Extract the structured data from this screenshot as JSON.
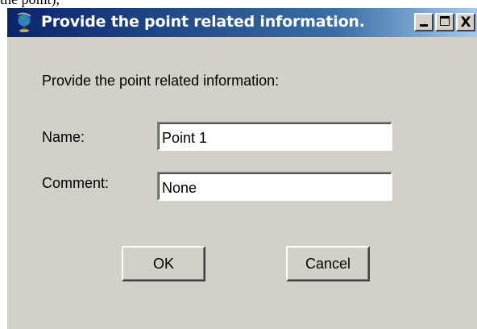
{
  "background_text": "the point),",
  "window": {
    "title": "Provide the point related information.",
    "icon": "globe-icon",
    "controls": {
      "minimize_icon": "minimize-icon",
      "maximize_icon": "maximize-icon",
      "close_label": "X"
    }
  },
  "form": {
    "prompt": "Provide the point related information:",
    "name_label": "Name:",
    "name_value": "Point 1",
    "comment_label": "Comment:",
    "comment_value": "None"
  },
  "buttons": {
    "ok_label": "OK",
    "cancel_label": "Cancel"
  },
  "colors": {
    "titlebar_start": "#0a246a",
    "titlebar_end": "#a6caf0",
    "dialog_face": "#d4d0c8"
  }
}
